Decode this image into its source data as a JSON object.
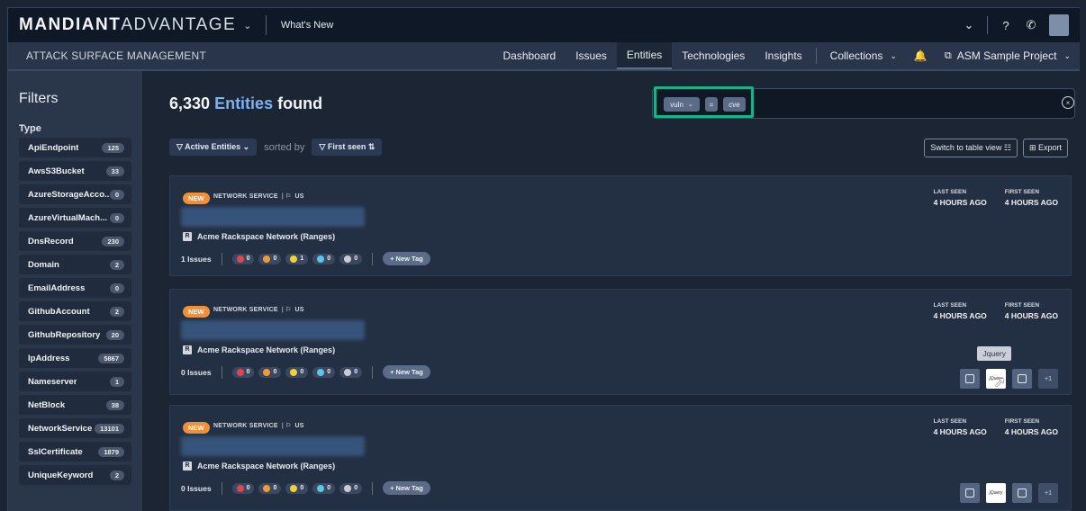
{
  "topbar": {
    "brand_bold": "MANDIANT",
    "brand_light": "ADVANTAGE",
    "whats_new": "What's New"
  },
  "navbar": {
    "product": "ATTACK SURFACE MANAGEMENT",
    "items": [
      "Dashboard",
      "Issues",
      "Entities",
      "Technologies",
      "Insights"
    ],
    "active": "Entities",
    "collections": "Collections",
    "project": "ASM Sample Project"
  },
  "sidebar": {
    "title": "Filters",
    "type_title": "Type",
    "items": [
      {
        "label": "ApiEndpoint",
        "count": "125"
      },
      {
        "label": "AwsS3Bucket",
        "count": "33"
      },
      {
        "label": "AzureStorageAcco...",
        "count": "0"
      },
      {
        "label": "AzureVirtualMach...",
        "count": "0"
      },
      {
        "label": "DnsRecord",
        "count": "230"
      },
      {
        "label": "Domain",
        "count": "2"
      },
      {
        "label": "EmailAddress",
        "count": "0"
      },
      {
        "label": "GithubAccount",
        "count": "2"
      },
      {
        "label": "GithubRepository",
        "count": "20"
      },
      {
        "label": "IpAddress",
        "count": "5867"
      },
      {
        "label": "Nameserver",
        "count": "1"
      },
      {
        "label": "NetBlock",
        "count": "38"
      },
      {
        "label": "NetworkService",
        "count": "13101"
      },
      {
        "label": "SslCertificate",
        "count": "1879"
      },
      {
        "label": "UniqueKeyword",
        "count": "2"
      }
    ]
  },
  "main": {
    "count": "6,330",
    "count_word": "Entities",
    "found_suffix": "found",
    "search": {
      "field": "vuln",
      "op": "=",
      "value": "cve"
    },
    "filter_btn": "Active Entities",
    "sorted_by": "sorted by",
    "sort_btn": "First seen",
    "switch_view": "Switch to table view",
    "export": "Export"
  },
  "cards": [
    {
      "badge": "NEW",
      "type": "NETWORK SERVICE",
      "country": "US",
      "network": "Acme Rackspace Network (Ranges)",
      "issues": "1 Issues",
      "sev": [
        "0",
        "0",
        "1",
        "0",
        "0"
      ],
      "new_tag": "+ New Tag",
      "last_seen_k": "LAST SEEN",
      "last_seen": "4 HOURS AGO",
      "first_seen_k": "FIRST SEEN",
      "first_seen": "4 HOURS AGO"
    },
    {
      "badge": "NEW",
      "type": "NETWORK SERVICE",
      "country": "US",
      "network": "Acme Rackspace Network (Ranges)",
      "issues": "0 Issues",
      "sev": [
        "0",
        "0",
        "0",
        "0",
        "0"
      ],
      "new_tag": "+ New Tag",
      "last_seen_k": "LAST SEEN",
      "last_seen": "4 HOURS AGO",
      "first_seen_k": "FIRST SEEN",
      "first_seen": "4 HOURS AGO",
      "tooltip": "Jquery",
      "more": "+1"
    },
    {
      "badge": "NEW",
      "type": "NETWORK SERVICE",
      "country": "US",
      "network": "Acme Rackspace Network (Ranges)",
      "issues": "0 Issues",
      "sev": [
        "0",
        "0",
        "0",
        "0",
        "0"
      ],
      "new_tag": "+ New Tag",
      "last_seen_k": "LAST SEEN",
      "last_seen": "4 HOURS AGO",
      "first_seen_k": "FIRST SEEN",
      "first_seen": "4 HOURS AGO",
      "more": "+1"
    }
  ],
  "colors": {
    "critical": "#e04554",
    "high": "#f29a3a",
    "medium": "#f2d03a",
    "low": "#5ec4e8",
    "info": "#c8cdd5",
    "accent": "#19b38b"
  },
  "tech_logo_text": "jQuery"
}
